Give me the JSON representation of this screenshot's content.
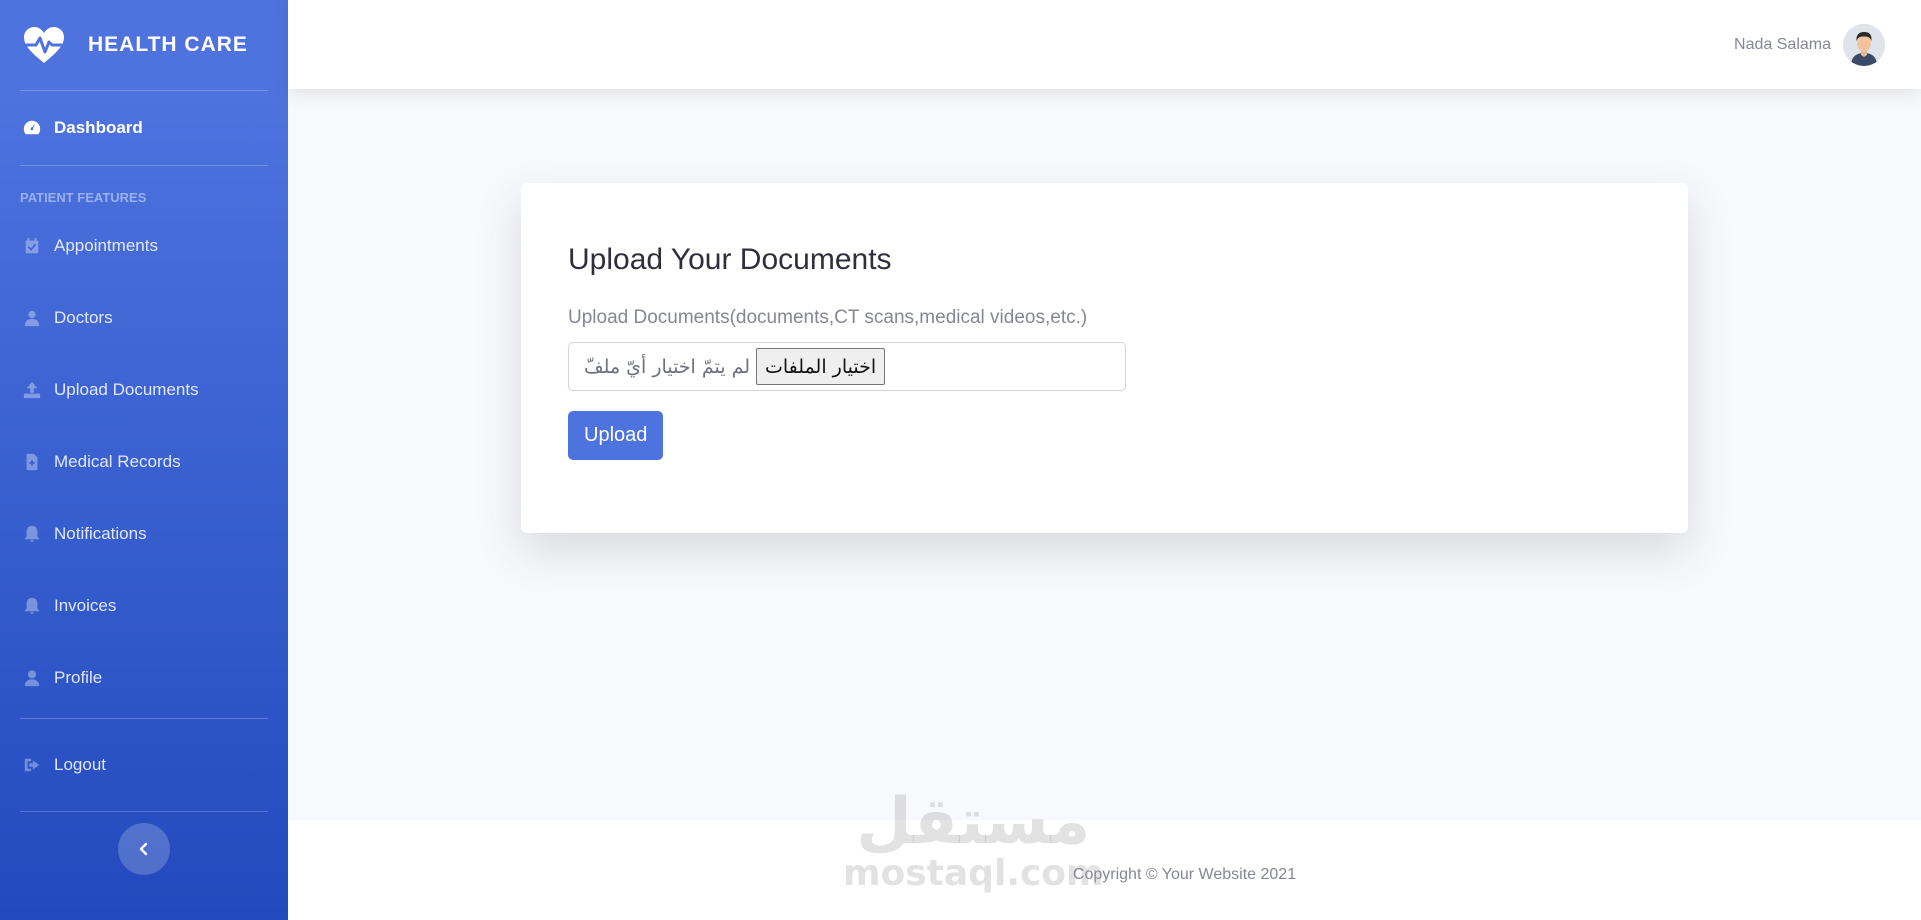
{
  "brand": {
    "name": "HEALTH CARE",
    "icon": "heartbeat-icon"
  },
  "sidebar": {
    "dashboard": {
      "label": "Dashboard",
      "icon": "tachometer-icon"
    },
    "heading": "PATIENT FEATURES",
    "items": [
      {
        "label": "Appointments",
        "icon": "calendar-check-icon"
      },
      {
        "label": "Doctors",
        "icon": "user-doctor-icon"
      },
      {
        "label": "Upload Documents",
        "icon": "upload-icon"
      },
      {
        "label": "Medical Records",
        "icon": "file-medical-icon"
      },
      {
        "label": "Notifications",
        "icon": "bell-icon"
      },
      {
        "label": "Invoices",
        "icon": "bell-icon"
      },
      {
        "label": "Profile",
        "icon": "user-icon"
      }
    ],
    "logout": {
      "label": "Logout",
      "icon": "sign-out-icon"
    },
    "toggle_icon": "chevron-left-icon"
  },
  "topbar": {
    "user_name": "Nada Salama"
  },
  "card": {
    "title": "Upload Your Documents",
    "field_label": "Upload Documents(documents,CT scans,medical videos,etc.)",
    "file_button": "اختيار الملفات",
    "file_status": "لم يتمّ اختيار أيّ ملفّ",
    "upload_button": "Upload"
  },
  "footer": {
    "copyright": "Copyright © Your Website 2021"
  },
  "watermark": {
    "arabic": "مستقل",
    "latin": "mostaql.com"
  },
  "colors": {
    "primary": "#4e73df",
    "primary_dark": "#224abe",
    "background": "#f8f9fc",
    "muted_text": "#858796"
  }
}
